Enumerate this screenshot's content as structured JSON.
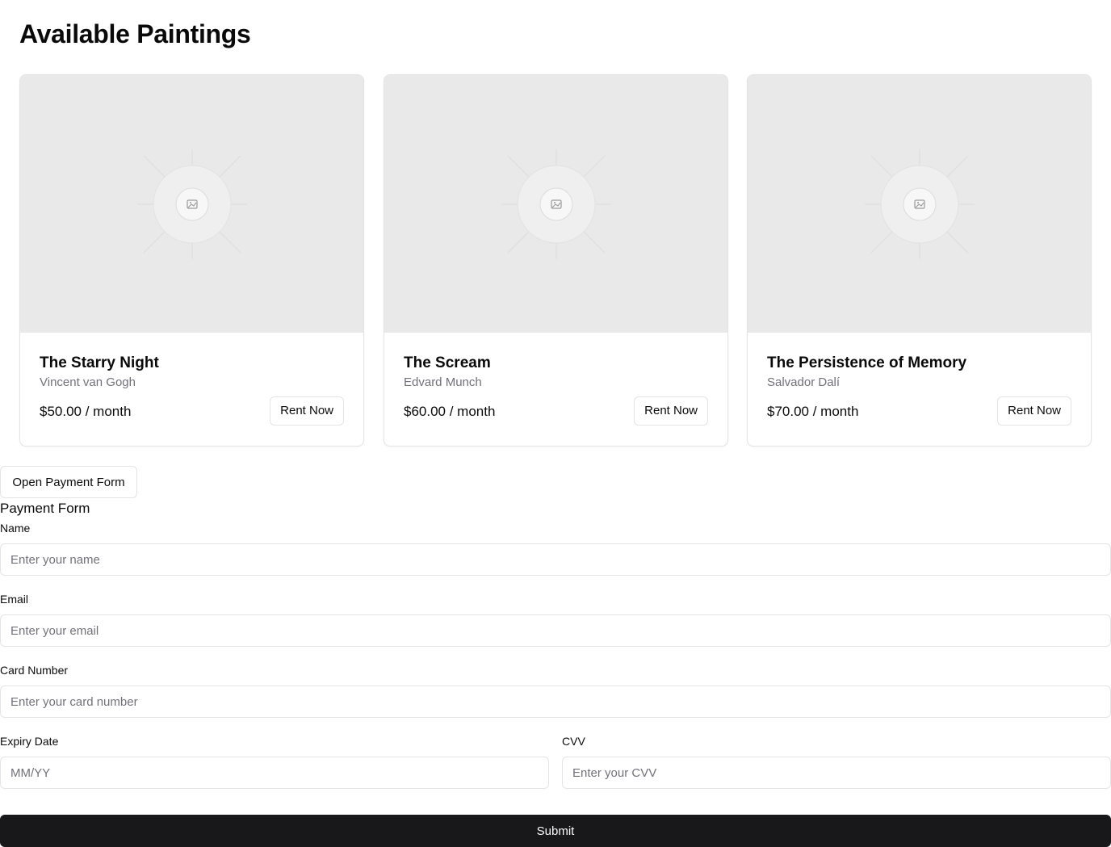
{
  "page": {
    "title": "Available Paintings"
  },
  "paintings": [
    {
      "title": "The Starry Night",
      "artist": "Vincent van Gogh",
      "price": "$50.00 / month",
      "button_label": "Rent Now",
      "image_icon": "image-placeholder-icon"
    },
    {
      "title": "The Scream",
      "artist": "Edvard Munch",
      "price": "$60.00 / month",
      "button_label": "Rent Now",
      "image_icon": "image-placeholder-icon"
    },
    {
      "title": "The Persistence of Memory",
      "artist": "Salvador Dalí",
      "price": "$70.00 / month",
      "button_label": "Rent Now",
      "image_icon": "image-placeholder-icon"
    }
  ],
  "payment": {
    "open_button_label": "Open Payment Form",
    "form_title": "Payment Form",
    "fields": {
      "name": {
        "label": "Name",
        "placeholder": "Enter your name",
        "value": ""
      },
      "email": {
        "label": "Email",
        "placeholder": "Enter your email",
        "value": ""
      },
      "card_number": {
        "label": "Card Number",
        "placeholder": "Enter your card number",
        "value": ""
      },
      "expiry": {
        "label": "Expiry Date",
        "placeholder": "MM/YY",
        "value": ""
      },
      "cvv": {
        "label": "CVV",
        "placeholder": "Enter your CVV",
        "value": ""
      }
    },
    "submit_label": "Submit"
  },
  "colors": {
    "primary_button": "#18181b",
    "border": "#e4e4e7",
    "muted_text": "#71717a",
    "image_placeholder_bg": "#e9e9e9"
  }
}
